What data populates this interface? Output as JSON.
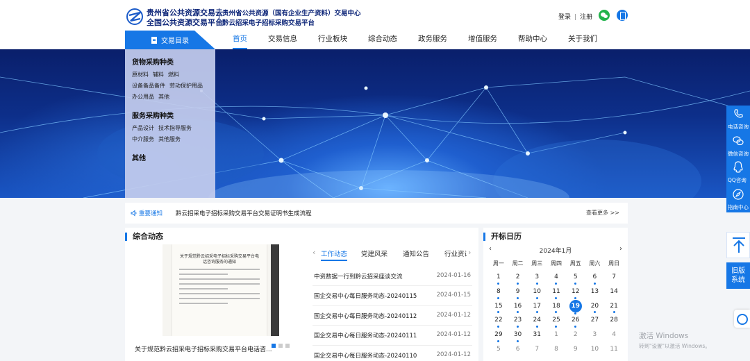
{
  "header": {
    "logo_line1": "贵州省公共资源交易云",
    "logo_line2": "全国公共资源交易平台",
    "logo_line3": "贵州省公共资源（国有企业生产资料）交易中心",
    "logo_line4": "黔云招采电子招标采购交易平台",
    "login": "登录",
    "register": "注册"
  },
  "nav": {
    "catalog_label": "交易目录",
    "items": [
      "首页",
      "交易信息",
      "行业板块",
      "综合动态",
      "政务服务",
      "增值服务",
      "帮助中心",
      "关于我们"
    ]
  },
  "catalog": {
    "groups": [
      {
        "title": "货物采购种类",
        "rows": [
          [
            "原材料",
            "辅料",
            "燃料"
          ],
          [
            "设备备品备件",
            "劳动保护用品"
          ],
          [
            "办公用品",
            "其他"
          ]
        ]
      },
      {
        "title": "服务采购种类",
        "rows": [
          [
            "产品设计",
            "技术指导服务"
          ],
          [
            "中介服务",
            "其他服务"
          ]
        ]
      },
      {
        "title": "其他",
        "rows": []
      }
    ]
  },
  "notice": {
    "label": "重要通知",
    "text": "黔云招采电子招标采购交易平台交易证明书生成流程",
    "more": "查看更多 >>"
  },
  "dynamics": {
    "title": "综合动态",
    "doc_heading": "关于规范黔云招采电子招标采购交易平台电话咨询服务的通知",
    "caption": "关于规范黔云招采电子招标采购交易平台电话咨...",
    "tabs": [
      "工作动态",
      "党建风采",
      "通知公告",
      "行业资讯"
    ],
    "news": [
      {
        "title": "中资数据一行到黔云招采座谈交流",
        "date": "2024-01-16"
      },
      {
        "title": "国企交易中心每日服务动态-20240115",
        "date": "2024-01-15"
      },
      {
        "title": "国企交易中心每日服务动态-20240112",
        "date": "2024-01-12"
      },
      {
        "title": "国企交易中心每日服务动态-20240111",
        "date": "2024-01-12"
      },
      {
        "title": "国企交易中心每日服务动态-20240110",
        "date": "2024-01-12"
      }
    ]
  },
  "calendar": {
    "title": "开标日历",
    "month": "2024年1月",
    "weekdays": [
      "周一",
      "周二",
      "周三",
      "周四",
      "周五",
      "周六",
      "周日"
    ],
    "days": [
      {
        "d": "1",
        "dot": true
      },
      {
        "d": "2",
        "dot": true
      },
      {
        "d": "3",
        "dot": true
      },
      {
        "d": "4",
        "dot": true
      },
      {
        "d": "5",
        "dot": true
      },
      {
        "d": "6",
        "dot": true
      },
      {
        "d": "7",
        "dot": false
      },
      {
        "d": "8",
        "dot": true
      },
      {
        "d": "9",
        "dot": true
      },
      {
        "d": "10",
        "dot": true
      },
      {
        "d": "11",
        "dot": true
      },
      {
        "d": "12",
        "dot": true
      },
      {
        "d": "13",
        "dot": false
      },
      {
        "d": "14",
        "dot": false
      },
      {
        "d": "15",
        "dot": true
      },
      {
        "d": "16",
        "dot": true
      },
      {
        "d": "17",
        "dot": true
      },
      {
        "d": "18",
        "dot": true
      },
      {
        "d": "19",
        "dot": true,
        "today": true
      },
      {
        "d": "20",
        "dot": true
      },
      {
        "d": "21",
        "dot": true
      },
      {
        "d": "22",
        "dot": true
      },
      {
        "d": "23",
        "dot": true
      },
      {
        "d": "24",
        "dot": true
      },
      {
        "d": "25",
        "dot": true
      },
      {
        "d": "26",
        "dot": true
      },
      {
        "d": "27",
        "dot": false
      },
      {
        "d": "28",
        "dot": false
      },
      {
        "d": "29",
        "dot": true
      },
      {
        "d": "30",
        "dot": true
      },
      {
        "d": "31",
        "dot": false
      },
      {
        "d": "1",
        "other": true
      },
      {
        "d": "2",
        "other": true
      },
      {
        "d": "3",
        "other": true
      },
      {
        "d": "4",
        "other": true
      },
      {
        "d": "5",
        "other": true
      },
      {
        "d": "6",
        "other": true
      },
      {
        "d": "7",
        "other": true
      },
      {
        "d": "8",
        "other": true
      },
      {
        "d": "9",
        "other": true
      },
      {
        "d": "10",
        "other": true
      },
      {
        "d": "11",
        "other": true
      }
    ]
  },
  "sidebar": {
    "items": [
      "电话咨询",
      "微信咨询",
      "QQ咨询",
      "指南中心"
    ],
    "old_system": "旧版系统"
  },
  "watermark": {
    "line1": "激活 Windows",
    "line2": "转到\"设置\"以激活 Windows。"
  },
  "colors": {
    "accent": "#1677e6",
    "brand_text": "#10287a",
    "wechat": "#22b34b"
  }
}
